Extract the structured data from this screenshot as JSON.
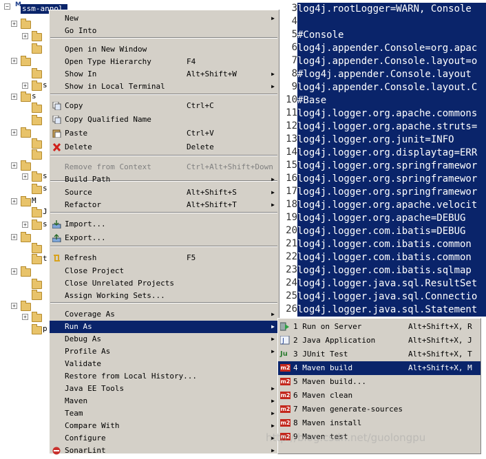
{
  "explorer": {
    "project_label": "ssm-annol",
    "items": [
      "s",
      "s",
      "s",
      "s",
      "M",
      "J",
      "s",
      "t",
      "p"
    ]
  },
  "editor": {
    "lines": [
      {
        "num": "3",
        "text": "log4j.rootLogger=WARN, Console"
      },
      {
        "num": "4",
        "text": ""
      },
      {
        "num": "5",
        "text": "#Console"
      },
      {
        "num": "6",
        "text": "log4j.appender.Console=org.apac"
      },
      {
        "num": "7",
        "text": "log4j.appender.Console.layout=o"
      },
      {
        "num": "8",
        "text": "#log4j.appender.Console.layout"
      },
      {
        "num": "9",
        "text": "log4j.appender.Console.layout.C"
      },
      {
        "num": "10",
        "text": "#Base"
      },
      {
        "num": "11",
        "text": "log4j.logger.org.apache.commons"
      },
      {
        "num": "12",
        "text": "log4j.logger.org.apache.struts="
      },
      {
        "num": "13",
        "text": "log4j.logger.org.junit=INFO"
      },
      {
        "num": "14",
        "text": "log4j.logger.org.displaytag=ERR"
      },
      {
        "num": "15",
        "text": "log4j.logger.org.springframewor"
      },
      {
        "num": "16",
        "text": "log4j.logger.org.springframewor"
      },
      {
        "num": "17",
        "text": "log4j.logger.org.springframewor"
      },
      {
        "num": "18",
        "text": "log4j.logger.org.apache.velocit"
      },
      {
        "num": "19",
        "text": "log4j.logger.org.apache=DEBUG"
      },
      {
        "num": "20",
        "text": "log4j.logger.com.ibatis=DEBUG"
      },
      {
        "num": "21",
        "text": "log4j.logger.com.ibatis.common"
      },
      {
        "num": "22",
        "text": "log4j.logger.com.ibatis.common"
      },
      {
        "num": "23",
        "text": "log4j.logger.com.ibatis.sqlmap"
      },
      {
        "num": "24",
        "text": "log4j.logger.java.sql.ResultSet"
      },
      {
        "num": "25",
        "text": "log4j.logger.java.sql.Connectio"
      },
      {
        "num": "26",
        "text": "log4j.logger.java.sql.Statement"
      }
    ]
  },
  "context_menu": {
    "items": [
      {
        "label": "New",
        "shortcut": "",
        "submenu": true,
        "disabled": false,
        "icon": ""
      },
      {
        "label": "Go Into",
        "shortcut": "",
        "submenu": false,
        "disabled": false,
        "icon": ""
      },
      {
        "label": "Open in New Window",
        "shortcut": "",
        "submenu": false,
        "disabled": false,
        "icon": ""
      },
      {
        "label": "Open Type Hierarchy",
        "shortcut": "F4",
        "submenu": false,
        "disabled": false,
        "icon": ""
      },
      {
        "label": "Show In",
        "shortcut": "Alt+Shift+W",
        "submenu": true,
        "disabled": false,
        "icon": ""
      },
      {
        "label": "Show in Local Terminal",
        "shortcut": "",
        "submenu": true,
        "disabled": false,
        "icon": ""
      },
      {
        "label": "Copy",
        "shortcut": "Ctrl+C",
        "submenu": false,
        "disabled": false,
        "icon": "copy-icon"
      },
      {
        "label": "Copy Qualified Name",
        "shortcut": "",
        "submenu": false,
        "disabled": false,
        "icon": "copy-qualified-icon"
      },
      {
        "label": "Paste",
        "shortcut": "Ctrl+V",
        "submenu": false,
        "disabled": false,
        "icon": "paste-icon"
      },
      {
        "label": "Delete",
        "shortcut": "Delete",
        "submenu": false,
        "disabled": false,
        "icon": "delete-icon"
      },
      {
        "label": "Remove from Context",
        "shortcut": "Ctrl+Alt+Shift+Down",
        "submenu": false,
        "disabled": true,
        "icon": ""
      },
      {
        "label": "Build Path",
        "shortcut": "",
        "submenu": true,
        "disabled": false,
        "icon": ""
      },
      {
        "label": "Source",
        "shortcut": "Alt+Shift+S",
        "submenu": true,
        "disabled": false,
        "icon": ""
      },
      {
        "label": "Refactor",
        "shortcut": "Alt+Shift+T",
        "submenu": true,
        "disabled": false,
        "icon": ""
      },
      {
        "label": "Import...",
        "shortcut": "",
        "submenu": false,
        "disabled": false,
        "icon": "import-icon"
      },
      {
        "label": "Export...",
        "shortcut": "",
        "submenu": false,
        "disabled": false,
        "icon": "export-icon"
      },
      {
        "label": "Refresh",
        "shortcut": "F5",
        "submenu": false,
        "disabled": false,
        "icon": "refresh-icon"
      },
      {
        "label": "Close Project",
        "shortcut": "",
        "submenu": false,
        "disabled": false,
        "icon": ""
      },
      {
        "label": "Close Unrelated Projects",
        "shortcut": "",
        "submenu": false,
        "disabled": false,
        "icon": ""
      },
      {
        "label": "Assign Working Sets...",
        "shortcut": "",
        "submenu": false,
        "disabled": false,
        "icon": ""
      },
      {
        "label": "Coverage As",
        "shortcut": "",
        "submenu": true,
        "disabled": false,
        "icon": ""
      },
      {
        "label": "Run As",
        "shortcut": "",
        "submenu": true,
        "disabled": false,
        "icon": ""
      },
      {
        "label": "Debug As",
        "shortcut": "",
        "submenu": true,
        "disabled": false,
        "icon": ""
      },
      {
        "label": "Profile As",
        "shortcut": "",
        "submenu": true,
        "disabled": false,
        "icon": ""
      },
      {
        "label": "Validate",
        "shortcut": "",
        "submenu": false,
        "disabled": false,
        "icon": ""
      },
      {
        "label": "Restore from Local History...",
        "shortcut": "",
        "submenu": false,
        "disabled": false,
        "icon": ""
      },
      {
        "label": "Java EE Tools",
        "shortcut": "",
        "submenu": true,
        "disabled": false,
        "icon": ""
      },
      {
        "label": "Maven",
        "shortcut": "",
        "submenu": true,
        "disabled": false,
        "icon": ""
      },
      {
        "label": "Team",
        "shortcut": "",
        "submenu": true,
        "disabled": false,
        "icon": ""
      },
      {
        "label": "Compare With",
        "shortcut": "",
        "submenu": true,
        "disabled": false,
        "icon": ""
      },
      {
        "label": "Configure",
        "shortcut": "",
        "submenu": true,
        "disabled": false,
        "icon": ""
      },
      {
        "label": "SonarLint",
        "shortcut": "",
        "submenu": true,
        "disabled": false,
        "icon": "sonarlint-icon"
      }
    ],
    "highlighted": "Run As"
  },
  "run_as_submenu": {
    "items": [
      {
        "label": "1 Run on Server",
        "shortcut": "Alt+Shift+X, R",
        "icon": "run-on-server-icon"
      },
      {
        "label": "2 Java Application",
        "shortcut": "Alt+Shift+X, J",
        "icon": "java-app-icon"
      },
      {
        "label": "3 JUnit Test",
        "shortcut": "Alt+Shift+X, T",
        "icon": "junit-icon"
      },
      {
        "label": "4 Maven build",
        "shortcut": "Alt+Shift+X, M",
        "icon": "maven-icon"
      },
      {
        "label": "5 Maven build...",
        "shortcut": "",
        "icon": "maven-icon"
      },
      {
        "label": "6 Maven clean",
        "shortcut": "",
        "icon": "maven-icon"
      },
      {
        "label": "7 Maven generate-sources",
        "shortcut": "",
        "icon": "maven-icon"
      },
      {
        "label": "8 Maven install",
        "shortcut": "",
        "icon": "maven-icon"
      },
      {
        "label": "9 Maven test",
        "shortcut": "",
        "icon": "maven-icon"
      }
    ],
    "highlighted": "4 Maven build",
    "maven_badge": "m2",
    "junit_badge": "Ju"
  },
  "watermark": "http://blog.csdn.net/guolongpu",
  "colors": {
    "selection": "#0a246a",
    "menu_bg": "#d4d0c8",
    "maven_red": "#c3271c"
  }
}
